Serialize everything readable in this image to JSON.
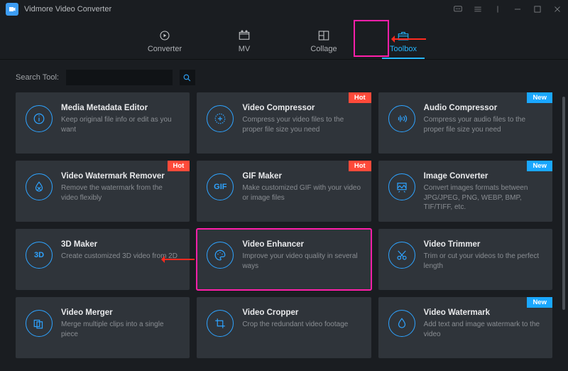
{
  "app": {
    "title": "Vidmore Video Converter"
  },
  "nav": {
    "items": [
      {
        "id": "converter",
        "label": "Converter"
      },
      {
        "id": "mv",
        "label": "MV"
      },
      {
        "id": "collage",
        "label": "Collage"
      },
      {
        "id": "toolbox",
        "label": "Toolbox"
      }
    ],
    "active": "toolbox"
  },
  "search": {
    "label": "Search Tool:",
    "placeholder": ""
  },
  "badges": {
    "hot": "Hot",
    "new": "New"
  },
  "tools": [
    {
      "id": "media-metadata-editor",
      "title": "Media Metadata Editor",
      "desc": "Keep original file info or edit as you want",
      "badge": null,
      "icon": "info"
    },
    {
      "id": "video-compressor",
      "title": "Video Compressor",
      "desc": "Compress your video files to the proper file size you need",
      "badge": "hot",
      "icon": "compress"
    },
    {
      "id": "audio-compressor",
      "title": "Audio Compressor",
      "desc": "Compress your audio files to the proper file size you need",
      "badge": "new",
      "icon": "audio-compress"
    },
    {
      "id": "video-watermark-remover",
      "title": "Video Watermark Remover",
      "desc": "Remove the watermark from the video flexibly",
      "badge": "hot",
      "icon": "drop-x"
    },
    {
      "id": "gif-maker",
      "title": "GIF Maker",
      "desc": "Make customized GIF with your video or image files",
      "badge": "hot",
      "icon": "gif"
    },
    {
      "id": "image-converter",
      "title": "Image Converter",
      "desc": "Convert images formats between JPG/JPEG, PNG, WEBP, BMP, TIF/TIFF, etc.",
      "badge": "new",
      "icon": "img-convert"
    },
    {
      "id": "3d-maker",
      "title": "3D Maker",
      "desc": "Create customized 3D video from 2D",
      "badge": null,
      "icon": "3d"
    },
    {
      "id": "video-enhancer",
      "title": "Video Enhancer",
      "desc": "Improve your video quality in several ways",
      "badge": null,
      "icon": "palette",
      "highlight": true
    },
    {
      "id": "video-trimmer",
      "title": "Video Trimmer",
      "desc": "Trim or cut your videos to the perfect length",
      "badge": null,
      "icon": "scissors"
    },
    {
      "id": "video-merger",
      "title": "Video Merger",
      "desc": "Merge multiple clips into a single piece",
      "badge": null,
      "icon": "merge"
    },
    {
      "id": "video-cropper",
      "title": "Video Cropper",
      "desc": "Crop the redundant video footage",
      "badge": null,
      "icon": "crop"
    },
    {
      "id": "video-watermark",
      "title": "Video Watermark",
      "desc": "Add text and image watermark to the video",
      "badge": "new",
      "icon": "drop"
    }
  ],
  "annotations": {
    "nav_highlight_box": true,
    "nav_arrow": true,
    "enhancer_arrow": true
  }
}
